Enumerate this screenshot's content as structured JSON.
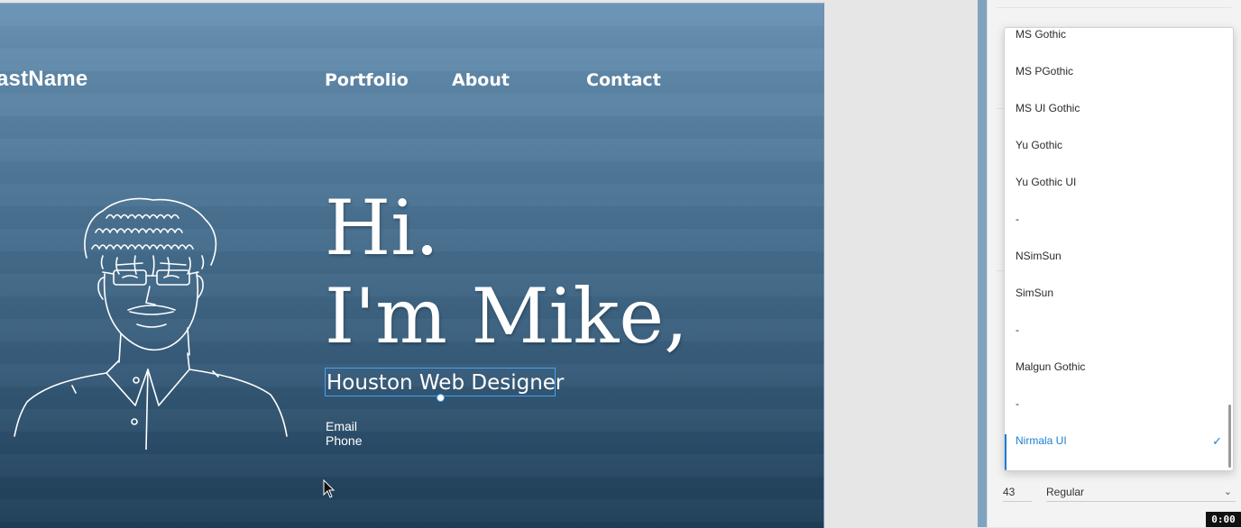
{
  "site": {
    "brand": "astName",
    "nav": [
      "Portfolio",
      "About",
      "Contact"
    ],
    "hero": [
      "Hi.",
      "I'm Mike,"
    ],
    "subtitle": "Houston Web Designer",
    "contact": {
      "email": "Email",
      "phone": "Phone"
    }
  },
  "font_dropdown": {
    "items": [
      "MS Gothic",
      "MS PGothic",
      "MS UI Gothic",
      "Yu Gothic",
      "Yu Gothic UI",
      "-",
      "NSimSun",
      "SimSun",
      "-",
      "Malgun Gothic",
      "-",
      "Nirmala UI"
    ],
    "selected": "Nirmala UI",
    "check_icon": "check-icon"
  },
  "text_props": {
    "size": "43",
    "weight": "Regular"
  },
  "status": {
    "timecode": "0:00"
  },
  "colors": {
    "accent": "#1a7fd4",
    "selection": "#4aa0f0"
  }
}
